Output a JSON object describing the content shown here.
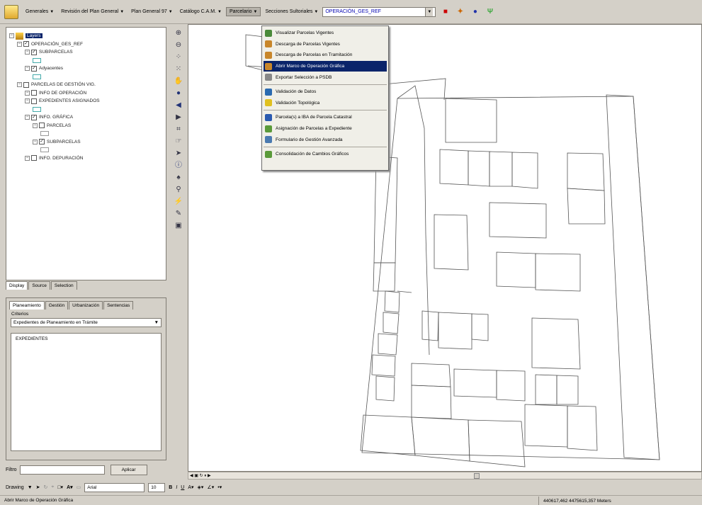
{
  "toolbar": {
    "menus": [
      {
        "label": "Generales",
        "open": false
      },
      {
        "label": "Revisión del Plan General",
        "open": false
      },
      {
        "label": "Plan General 97",
        "open": false
      },
      {
        "label": "Catálogo C.A.M.",
        "open": false
      },
      {
        "label": "Parcelario",
        "open": true
      },
      {
        "label": "Secciones Sultoriales",
        "open": false
      }
    ],
    "layer_combo": "OPERACIÓN_GES_REF"
  },
  "dropdown": {
    "items": [
      {
        "label": "Visualizar Parcelas Vigentes",
        "color": "#4a8a3a",
        "highlighted": false
      },
      {
        "label": "Descarga de Parcelas Vigentes",
        "color": "#c8862a",
        "highlighted": false
      },
      {
        "label": "Descarga de Parcelas en Tramitación",
        "color": "#c8862a",
        "highlighted": false
      },
      {
        "label": "Abrir Marco de Operación Gráfica",
        "color": "#c8862a",
        "highlighted": true
      },
      {
        "label": "Exportar Selección a PSDB",
        "color": "#888888",
        "highlighted": false,
        "sep_after": true
      },
      {
        "label": "Validación de Datos",
        "color": "#2a6ab0",
        "highlighted": false
      },
      {
        "label": "Validación Topológica",
        "color": "#e0c020",
        "highlighted": false,
        "sep_after": true
      },
      {
        "label": "Parcela(s) a IBA de Parcela Catastral",
        "color": "#2a5ab0",
        "highlighted": false
      },
      {
        "label": "Asignación de Parcelas a Expediente",
        "color": "#5a9a3a",
        "highlighted": false
      },
      {
        "label": "Formulario de Gestión Avanzada",
        "color": "#4a7ab0",
        "highlighted": false,
        "sep_after": true
      },
      {
        "label": "Consolidación de Cambios Gráficos",
        "color": "#5a9a3a",
        "highlighted": false
      }
    ]
  },
  "toc": {
    "rows": [
      {
        "indent": 0,
        "text": "Layers",
        "root": true
      },
      {
        "indent": 1,
        "text": "OPERACIÓN_GES_REF",
        "check": true
      },
      {
        "indent": 2,
        "text": "SUBPARCELAS",
        "check": true
      },
      {
        "indent": 3,
        "text": "",
        "symbol": true
      },
      {
        "indent": 2,
        "text": "Adyacentes",
        "check": true
      },
      {
        "indent": 3,
        "text": "",
        "symbol": true
      },
      {
        "indent": 1,
        "text": "PARCELAS DE GESTIÓN VIG.",
        "check": false
      },
      {
        "indent": 2,
        "text": "INFO DE OPERACIÓN",
        "check": false
      },
      {
        "indent": 2,
        "text": "EXPEDIENTES ASIGNADOS",
        "check": false
      },
      {
        "indent": 3,
        "text": "",
        "symbol": true
      },
      {
        "indent": 2,
        "text": "INFO. GRÁFICA",
        "check": true
      },
      {
        "indent": 3,
        "text": "PARCELAS",
        "check": false
      },
      {
        "indent": 4,
        "text": "",
        "symbol": true
      },
      {
        "indent": 3,
        "text": "SUBPARCELAS",
        "check": true
      },
      {
        "indent": 4,
        "text": "",
        "symbol": true
      },
      {
        "indent": 2,
        "text": "INFO. DEPURACIÓN",
        "check": false
      }
    ]
  },
  "toc_tabs": [
    "Display",
    "Source",
    "Selection"
  ],
  "lower_panel": {
    "tabs": [
      "Planeamiento",
      "Gestión",
      "Urbanización",
      "Sentencias"
    ],
    "criterio_label": "Criterios",
    "criterio_value": "Expedientes de Planeamiento en Trámite",
    "list_items": [
      "EXPEDIENTES"
    ],
    "filter_label": "Filtro",
    "apply_label": "Aplicar"
  },
  "drawing": {
    "label": "Drawing",
    "font": "Arial",
    "size": "10"
  },
  "status": {
    "message": "Abrir Marco de Operación Gráfica",
    "coords": "440617,462  4475615,357 Meters"
  }
}
